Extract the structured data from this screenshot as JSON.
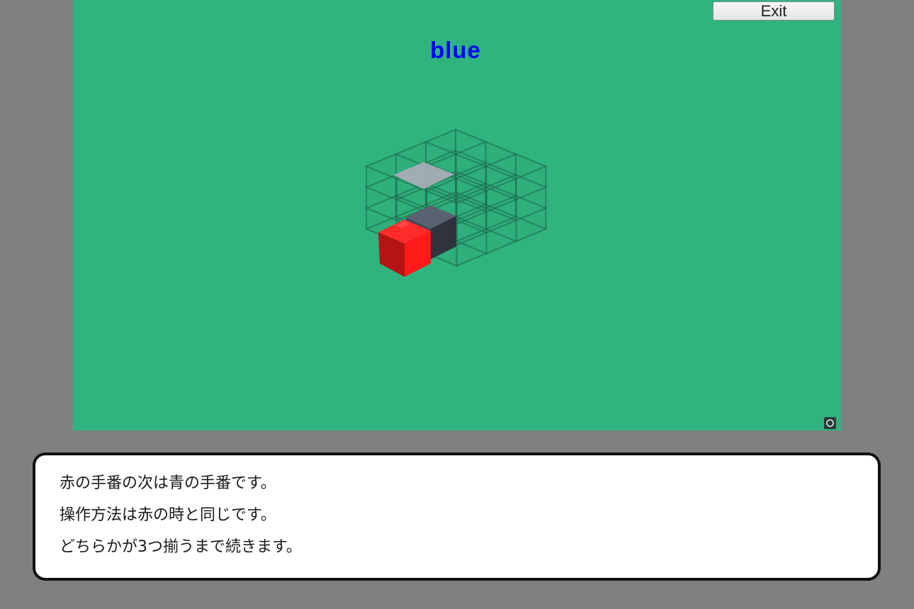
{
  "game": {
    "turn_label": "blue",
    "turn_color": "#0000ff",
    "background_color": "#2fb47f",
    "exit_label": "Exit",
    "board": {
      "grid_size": "3x3x3",
      "pieces": [
        {
          "color": "red",
          "hex": "#e81818"
        },
        {
          "color": "dark-gray",
          "hex": "#3d4450"
        },
        {
          "color": "light-gray",
          "hex": "#a6adb8"
        }
      ]
    },
    "corner_icon": "reload-icon"
  },
  "dialog": {
    "lines": [
      "赤の手番の次は青の手番です。",
      "操作方法は赤の時と同じです。",
      "どちらかが3つ揃うまで続きます。"
    ]
  }
}
